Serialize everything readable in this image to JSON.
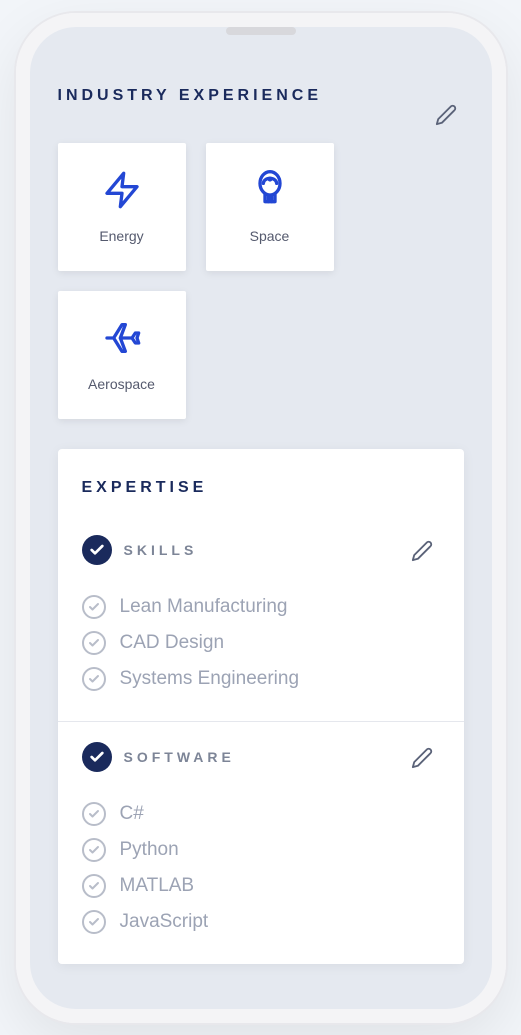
{
  "industry": {
    "title": "Industry Experience",
    "items": [
      {
        "label": "Energy",
        "icon": "bolt"
      },
      {
        "label": "Space",
        "icon": "astronaut"
      },
      {
        "label": "Aerospace",
        "icon": "plane"
      }
    ]
  },
  "expertise": {
    "title": "Expertise",
    "sections": [
      {
        "title": "Skills",
        "items": [
          "Lean Manufacturing",
          "CAD Design",
          "Systems Engineering"
        ]
      },
      {
        "title": "Software",
        "items": [
          "C#",
          "Python",
          "MATLAB",
          "JavaScript"
        ]
      }
    ]
  },
  "colors": {
    "accent": "#2347d4",
    "dark": "#1a2a5c"
  }
}
